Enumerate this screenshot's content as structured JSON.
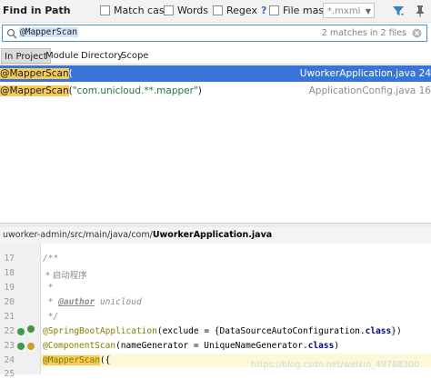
{
  "title": "Find in Path",
  "options": {
    "match_case": "Match case",
    "words": "Words",
    "regex": "Regex",
    "regex_help": "?",
    "file_mask": "File mask:",
    "file_mask_value": "*.mxml"
  },
  "search": {
    "query": "@MapperScan",
    "match_count": "2 matches in 2 files"
  },
  "scopes": [
    "In Project",
    "Module",
    "Directory",
    "Scope"
  ],
  "results": [
    {
      "match": "@MapperScan",
      "rest": "(",
      "file": "UworkerApplication.java 24"
    },
    {
      "match": "@MapperScan",
      "rest_pre": "(",
      "rest_str": "\"com.unicloud.**.mapper\"",
      "rest_post": ")",
      "file": "ApplicationConfig.java 16"
    }
  ],
  "preview": {
    "path_prefix": "uworker-admin/src/main/java/com/",
    "path_file": "UworkerApplication.java",
    "lines": [
      {
        "n": "17",
        "text": "/**"
      },
      {
        "n": "18",
        "text": " * 启动程序"
      },
      {
        "n": "19",
        "text": " *"
      },
      {
        "n": "20",
        "tag": "@author",
        "text": " unicloud"
      },
      {
        "n": "21",
        "text": " */"
      },
      {
        "n": "22",
        "ann": "@SpringBootApplication",
        "text_a": "(exclude = {DataSourceAutoConfiguration.",
        "kw": "class",
        "text_b": "})"
      },
      {
        "n": "23",
        "ann": "@ComponentScan",
        "text_a": "(nameGenerator = UniqueNameGenerator.",
        "kw": "class",
        "text_b": ")"
      },
      {
        "n": "24",
        "ann": "@MapperScan",
        "text_a": "({"
      },
      {
        "n": "25",
        "text": ""
      }
    ]
  },
  "watermark": "https://blog.csdn.net/weixin_49788300"
}
